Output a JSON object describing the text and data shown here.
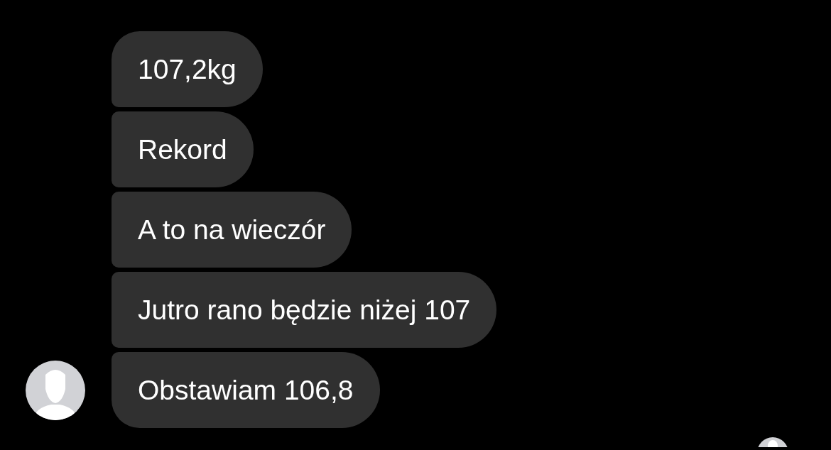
{
  "messages": [
    {
      "text": "107,2kg"
    },
    {
      "text": "Rekord"
    },
    {
      "text": "A to na wieczór"
    },
    {
      "text": "Jutro rano będzie niżej 107"
    },
    {
      "text": "Obstawiam 106,8"
    }
  ]
}
